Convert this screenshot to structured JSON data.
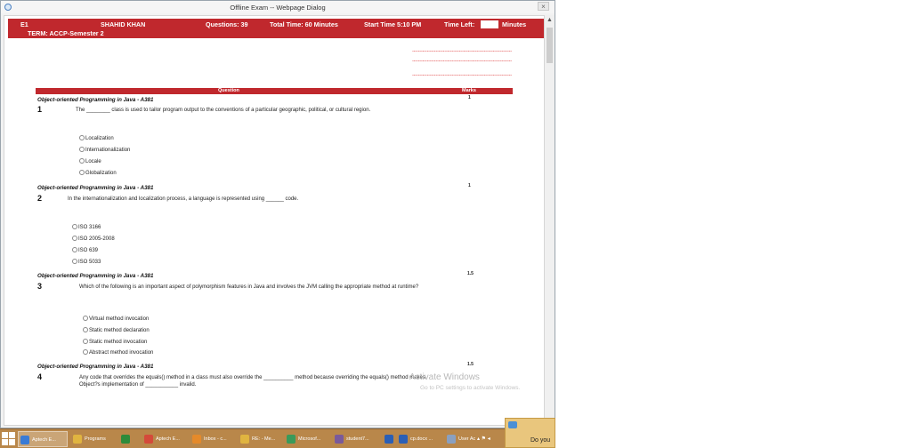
{
  "window": {
    "title": "Offline Exam -- Webpage Dialog",
    "close_label": "×"
  },
  "header": {
    "code": "E1",
    "student": "SHAHID KHAN",
    "questions": "Questions:  39",
    "total_time": "Total Time:  60 Minutes",
    "start_time": "Start Time  5:10 PM",
    "time_left_label": "Time Left:",
    "time_left_unit": "Minutes",
    "term": "TERM: ACCP-Semester 2"
  },
  "stars_line": "*******************************************************************************",
  "table_header": {
    "question": "Question",
    "marks": "Marks"
  },
  "questions": [
    {
      "subject": "Object-oriented Programming in Java - A381",
      "marks": "1",
      "number": "1",
      "text": "The ________ class is used to tailor program output to the conventions of a particular geographic, political, or cultural region.",
      "options": [
        "Localization",
        "Internationalization",
        "Locale",
        "Globalization"
      ]
    },
    {
      "subject": "Object-oriented Programming in Java - A381",
      "marks": "1",
      "number": "2",
      "text": "In the internationalization and localization process, a language is represented using ______ code.",
      "options": [
        "ISO 3166",
        "ISO 2005-2008",
        "ISO 639",
        "ISO 5033"
      ]
    },
    {
      "subject": "Object-oriented Programming in Java - A381",
      "marks": "1.5",
      "number": "3",
      "text": "Which of the following is an important aspect of polymorphism features in Java and involves the JVM calling the appropriate method at runtime?",
      "options": [
        "Virtual method invocation",
        "Static method declaration",
        "Static method invocation",
        "Abstract method invocation"
      ]
    },
    {
      "subject": "Object-oriented Programming in Java - A381",
      "marks": "1.5",
      "number": "4",
      "text": "Any code that overrides the equals() method in a class must also override the __________ method because overriding the equals() method makes Object?s implementation of ___________ invalid.",
      "options": []
    }
  ],
  "watermark": {
    "line1": "Activate Windows",
    "line2": "Go to PC settings to activate Windows."
  },
  "taskbar": {
    "items": [
      {
        "label": "Aptech E...",
        "color": "#3a7bd5"
      },
      {
        "label": "Programs",
        "color": "#e0b440"
      },
      {
        "label": "",
        "color": "#2e8b3a"
      },
      {
        "label": "Aptech E...",
        "color": "#d44a3a"
      },
      {
        "label": "Inbox - c...",
        "color": "#e58a2a"
      },
      {
        "label": "RE: - Me...",
        "color": "#e0b440"
      },
      {
        "label": "Microsof...",
        "color": "#3a9a5a"
      },
      {
        "label": "student7...",
        "color": "#7a5a9a"
      },
      {
        "label": "",
        "color": "#2b5fb5"
      },
      {
        "label": "cp.docx ...",
        "color": "#2b5fb5"
      },
      {
        "label": "User Acc...",
        "color": "#8aa0c0"
      }
    ],
    "notification": "Do you"
  },
  "colors": {
    "accent": "#c0282d",
    "taskbar": "#b9874a"
  }
}
